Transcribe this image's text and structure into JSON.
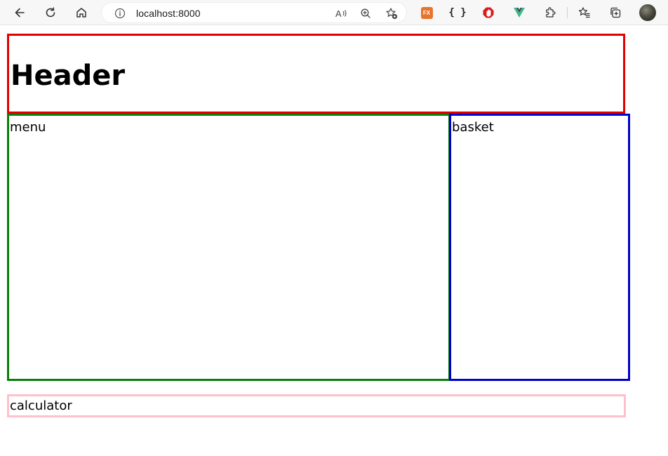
{
  "browser": {
    "url": "localhost:8000",
    "icons": [
      "back-icon",
      "refresh-icon",
      "home-icon",
      "info-icon",
      "read-aloud-icon",
      "zoom-icon",
      "add-favorite-icon",
      "extension-fx-icon",
      "extension-json-icon",
      "extension-adblock-icon",
      "extension-vue-icon",
      "extensions-icon",
      "favorites-icon",
      "collections-icon",
      "profile-avatar"
    ],
    "ext_fx_label": "FX",
    "ext_brace_label": "{ }"
  },
  "page": {
    "header_title": "Header",
    "menu_label": "menu",
    "basket_label": "basket",
    "calculator_label": "calculator"
  },
  "colors": {
    "header_border": "#e00000",
    "menu_border": "#0a7d0a",
    "basket_border": "#0000cc",
    "calculator_border": "#ffc0cb"
  }
}
